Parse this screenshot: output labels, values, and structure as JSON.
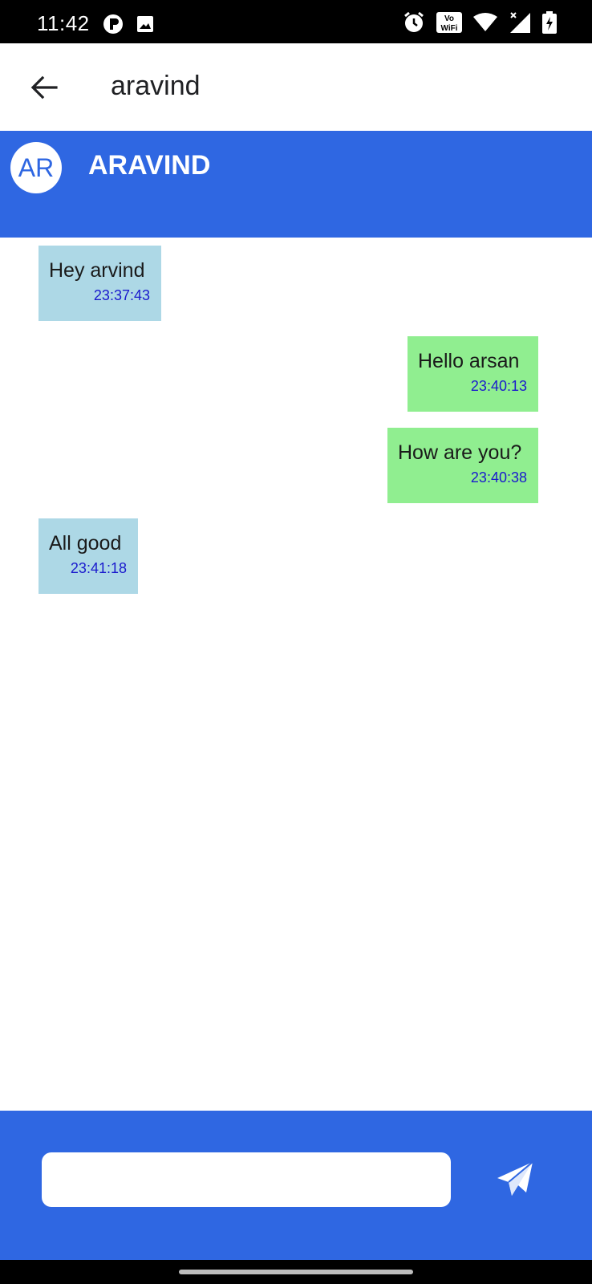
{
  "status_bar": {
    "time": "11:42",
    "left_icons": [
      "notification-r-icon",
      "image-icon"
    ],
    "right_icons": [
      "alarm-icon",
      "vowifi-icon",
      "wifi-icon",
      "signal-icon",
      "battery-charging-icon"
    ],
    "vowifi_text": [
      "Vo",
      "WiFi"
    ]
  },
  "app_bar": {
    "title": "aravind",
    "back_icon": "arrow-back-icon"
  },
  "contact_header": {
    "avatar_initials": "AR",
    "name": "ARAVIND",
    "color": "#2f67e2"
  },
  "messages": [
    {
      "direction": "incoming",
      "text": "Hey arvind",
      "time": "23:37:43"
    },
    {
      "direction": "outgoing",
      "text": "Hello arsan",
      "time": "23:40:13"
    },
    {
      "direction": "outgoing",
      "text": "How are you?",
      "time": "23:40:38"
    },
    {
      "direction": "incoming",
      "text": "All good",
      "time": "23:41:18"
    }
  ],
  "composer": {
    "input_value": "",
    "placeholder": "",
    "send_icon": "send-icon"
  },
  "colors": {
    "accent": "#2f67e2",
    "incoming_bubble": "#add8e6",
    "outgoing_bubble": "#90ee90",
    "timestamp": "#1a1acd"
  }
}
